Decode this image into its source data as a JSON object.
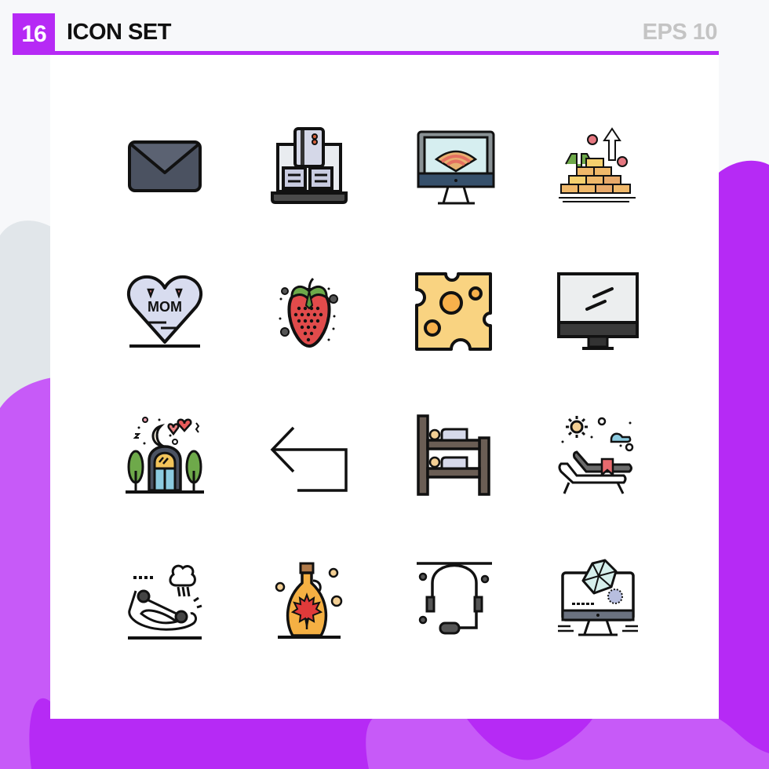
{
  "header": {
    "count": "16",
    "title": "ICON SET",
    "format": "EPS 10"
  },
  "colors": {
    "accent": "#b62af5",
    "accent_light": "#c75af8",
    "gray_blob": "#e1e6ea",
    "page_bg": "#f7f8fa",
    "panel": "#ffffff",
    "format_text": "#c4c4c4"
  },
  "icons": [
    {
      "name": "envelope-icon",
      "label": "Mail"
    },
    {
      "name": "laptop-credit-card-icon",
      "label": "Online payment"
    },
    {
      "name": "monitor-wifi-icon",
      "label": "Computer wifi"
    },
    {
      "name": "gold-bars-growth-icon",
      "label": "Gold investment"
    },
    {
      "name": "mom-heart-icon",
      "label": "Mom heart"
    },
    {
      "name": "strawberry-icon",
      "label": "Strawberry"
    },
    {
      "name": "cheese-icon",
      "label": "Cheese"
    },
    {
      "name": "monitor-icon",
      "label": "Monitor"
    },
    {
      "name": "mosque-night-icon",
      "label": "Mosque night"
    },
    {
      "name": "return-arrow-icon",
      "label": "Return arrow"
    },
    {
      "name": "bunk-bed-icon",
      "label": "Bunk bed"
    },
    {
      "name": "sun-lounger-icon",
      "label": "Sun lounger"
    },
    {
      "name": "car-crash-icon",
      "label": "Car accident"
    },
    {
      "name": "maple-syrup-icon",
      "label": "Maple syrup"
    },
    {
      "name": "headset-icon",
      "label": "Headset"
    },
    {
      "name": "computer-3d-model-icon",
      "label": "3D design computer"
    }
  ]
}
